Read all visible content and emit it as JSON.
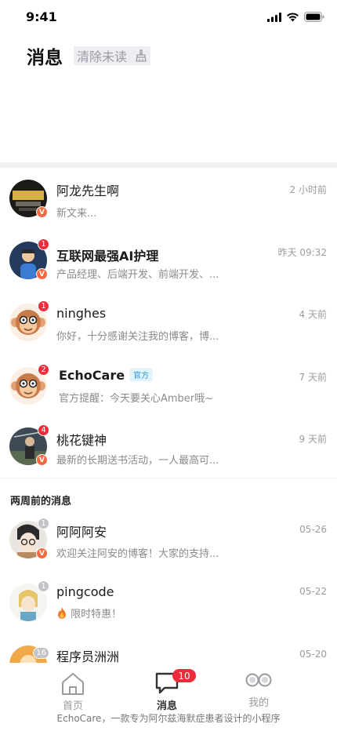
{
  "status": {
    "time": "9:41"
  },
  "header": {
    "title": "消息",
    "clear_label": "清除未读"
  },
  "items": [
    {
      "name": "阿龙先生啊",
      "preview": "新文来...",
      "time": "2 小时前",
      "unread": "",
      "verified": "V"
    },
    {
      "name": "互联网最强AI护理",
      "preview": "产品经理、后端开发、前端开发、...",
      "time": "昨天 09:32",
      "unread": "1",
      "verified": "V"
    },
    {
      "name": "ninghes",
      "preview": "你好，十分感谢关注我的博客，博...",
      "time": "4 天前",
      "unread": "1",
      "verified": ""
    },
    {
      "name": "EchoCare",
      "tag": "官方",
      "preview": "官方提醒：今天要关心Amber哦~",
      "time": "7 天前",
      "unread": "2",
      "verified": ""
    },
    {
      "name": "桃花键神",
      "preview": "最新的长期送书活动，一人最高可...",
      "time": "9 天前",
      "unread": "4",
      "verified": "V"
    }
  ],
  "older_section": {
    "title": "两周前的消息",
    "items": [
      {
        "name": "阿阿阿安",
        "preview": "欢迎关注阿安的博客！大家的支持...",
        "time": "05-26",
        "unread": "1",
        "verified": "V"
      },
      {
        "name": "pingcode",
        "preview": "限时特惠！",
        "time": "05-22",
        "unread": "1",
        "verified": ""
      },
      {
        "name": "程序员洲洲",
        "preview": "",
        "time": "05-20",
        "unread": "16",
        "verified": ""
      }
    ]
  },
  "tabbar": {
    "home_label": "首页",
    "messages_label": "消息",
    "messages_badge": "10",
    "mine_label": "我的",
    "footer": "EchoCare，一款专为阿尔兹海默症患者设计的小程序"
  },
  "colors": {
    "accent_red": "#ee2b3b",
    "verified_orange": "#f36a42",
    "official_blue": "#2a9bd6"
  }
}
